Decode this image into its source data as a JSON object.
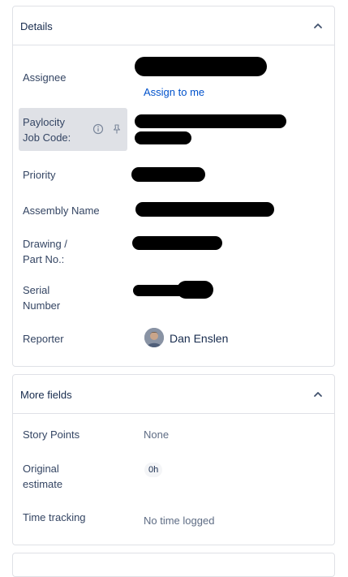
{
  "details": {
    "title": "Details",
    "collapse_icon": "chevron-up-icon",
    "fields": {
      "assignee": {
        "label": "Assignee",
        "action": "Assign to me"
      },
      "paylocity": {
        "label_line1": "Paylocity",
        "label_line2": "Job Code:",
        "info_icon": "info-icon",
        "pin_icon": "pin-icon"
      },
      "priority": {
        "label": "Priority"
      },
      "assembly_name": {
        "label": "Assembly Name"
      },
      "drawing": {
        "label_line1": "Drawing /",
        "label_line2": "Part No.:"
      },
      "serial": {
        "label_line1": "Serial",
        "label_line2": "Number"
      },
      "reporter": {
        "label": "Reporter",
        "value": "Dan Enslen"
      }
    }
  },
  "more_fields": {
    "title": "More fields",
    "collapse_icon": "chevron-up-icon",
    "fields": {
      "story_points": {
        "label": "Story Points",
        "value": "None"
      },
      "original_estimate": {
        "label_line1": "Original",
        "label_line2": "estimate",
        "value": "0h"
      },
      "time_tracking": {
        "label": "Time tracking",
        "value": "No time logged"
      }
    }
  },
  "colors": {
    "border": "#dfe1e6",
    "link": "#0052cc",
    "text": "#172b4d",
    "muted": "#5e6c84",
    "highlight": "#dfe1e6"
  }
}
